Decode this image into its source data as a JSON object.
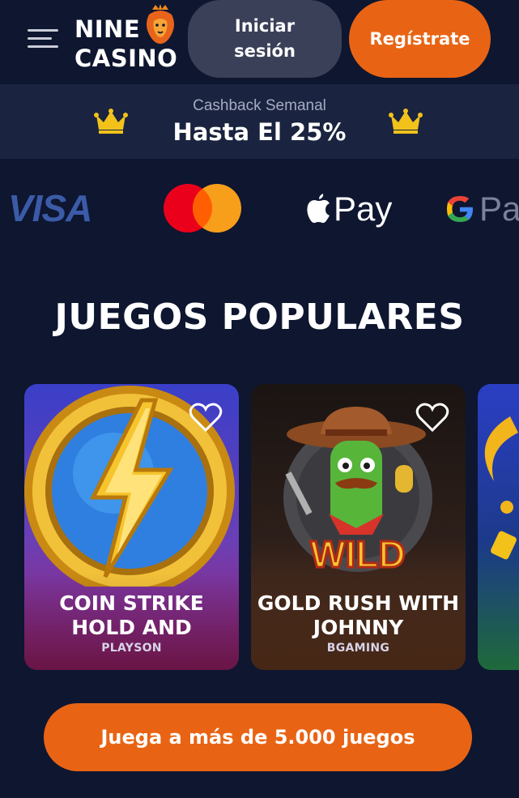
{
  "header": {
    "logo_line1": "NINE",
    "logo_line2": "CASINO",
    "login_label": "Iniciar sesión",
    "register_label": "Regístrate"
  },
  "cashback": {
    "title": "Cashback Semanal",
    "value": "Hasta El 25%"
  },
  "payments": {
    "visa": "VISA",
    "apple_pay": "Pay",
    "google_pay": "Pa"
  },
  "section": {
    "title": "JUEGOS POPULARES"
  },
  "games": [
    {
      "title": "COIN STRIKE HOLD AND",
      "provider": "PLAYSON"
    },
    {
      "title": "GOLD RUSH WITH JOHNNY",
      "provider": "BGAMING"
    }
  ],
  "cta": {
    "label": "Juega a más de 5.000 juegos"
  },
  "colors": {
    "background": "#0e1630",
    "banner": "#1a2440",
    "accent": "#e86414",
    "secondary_button": "#3a4058",
    "crown": "#f2c21b"
  },
  "icons": [
    "menu-icon",
    "lion-icon",
    "crown-icon",
    "apple-icon",
    "google-icon",
    "heart-icon"
  ]
}
